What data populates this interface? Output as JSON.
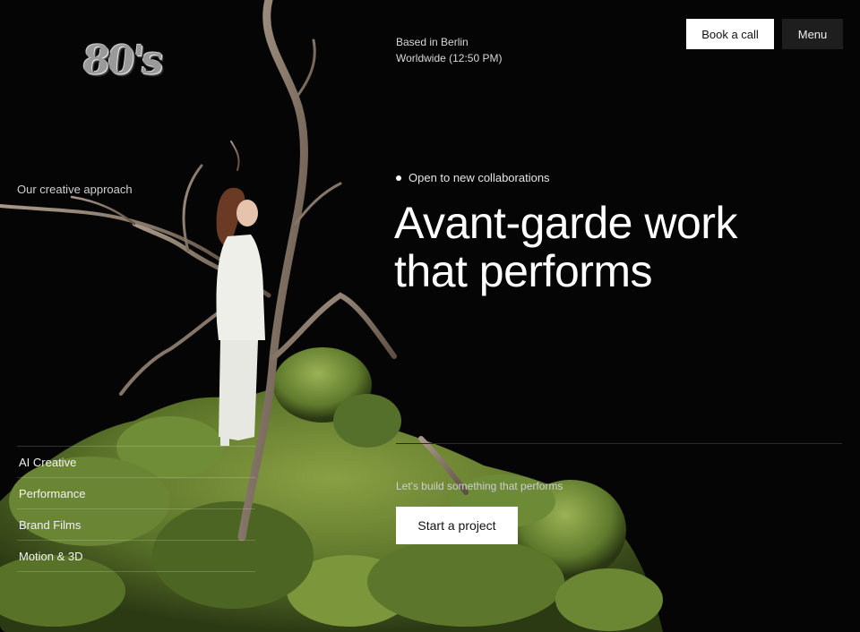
{
  "brand": {
    "logo_text": "80's"
  },
  "location": {
    "line1": "Based in Berlin",
    "line2": "Worldwide (12:50 PM)"
  },
  "nav": {
    "book_label": "Book a call",
    "menu_label": "Menu"
  },
  "approach_label": "Our creative approach",
  "hero": {
    "status": "Open to new collaborations",
    "headline_line1": "Avant-garde work",
    "headline_line2": "that performs"
  },
  "cta": {
    "tagline": "Let's build something that performs",
    "button_label": "Start a project"
  },
  "services": [
    {
      "label": "AI Creative"
    },
    {
      "label": "Performance"
    },
    {
      "label": "Brand Films"
    },
    {
      "label": "Motion & 3D"
    }
  ],
  "colors": {
    "background": "#050505",
    "moss": "#5f7a2e",
    "branch": "#8a7868",
    "figure": "#eeeeea"
  }
}
